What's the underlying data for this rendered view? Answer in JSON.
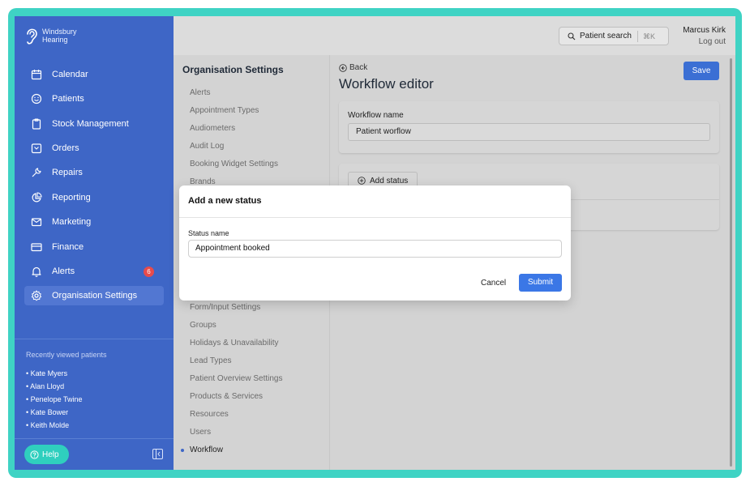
{
  "brand": {
    "name_line1": "Windsbury",
    "name_line2": "Hearing"
  },
  "colors": {
    "frame": "#3fd3c4",
    "sidebar": "#3e66c6",
    "primary_button": "#3b6fd4",
    "badge": "#e74b4b",
    "help": "#2fcfbe"
  },
  "sidebar": {
    "items": [
      {
        "label": "Calendar",
        "icon": "calendar-icon"
      },
      {
        "label": "Patients",
        "icon": "smiley-icon"
      },
      {
        "label": "Stock Management",
        "icon": "clipboard-icon"
      },
      {
        "label": "Orders",
        "icon": "inbox-icon"
      },
      {
        "label": "Repairs",
        "icon": "wrench-icon"
      },
      {
        "label": "Reporting",
        "icon": "pie-chart-icon"
      },
      {
        "label": "Marketing",
        "icon": "mail-icon"
      },
      {
        "label": "Finance",
        "icon": "credit-card-icon"
      },
      {
        "label": "Alerts",
        "icon": "bell-icon",
        "badge": "6"
      },
      {
        "label": "Organisation Settings",
        "icon": "gear-icon",
        "active": true
      }
    ],
    "recent_title": "Recently viewed patients",
    "recent_patients": [
      "• Kate Myers",
      "• Alan Lloyd",
      "• Penelope Twine",
      "• Kate Bower",
      "• Keith Molde"
    ],
    "help_label": "Help"
  },
  "topbar": {
    "search_label": "Patient search",
    "search_shortcut": "⌘K",
    "user_name": "Marcus Kirk",
    "logout_label": "Log out"
  },
  "settings_menu": {
    "title": "Organisation Settings",
    "items_top": [
      "Alerts",
      "Appointment Types",
      "Audiometers",
      "Audit Log",
      "Booking Widget Settings",
      "Brands"
    ],
    "items_bottom": [
      "Form/Input Settings",
      "Groups",
      "Holidays & Unavailability",
      "Lead Types",
      "Patient Overview Settings",
      "Products & Services",
      "Resources",
      "Users"
    ],
    "active_item": "Workflow"
  },
  "workflow": {
    "back_label": "Back",
    "title": "Workflow editor",
    "save_label": "Save",
    "name_label": "Workflow name",
    "name_value": "Patient worflow",
    "add_status_label": "Add status"
  },
  "modal": {
    "title": "Add a new status",
    "field_label": "Status name",
    "field_value": "Appointment booked",
    "cancel_label": "Cancel",
    "submit_label": "Submit"
  }
}
